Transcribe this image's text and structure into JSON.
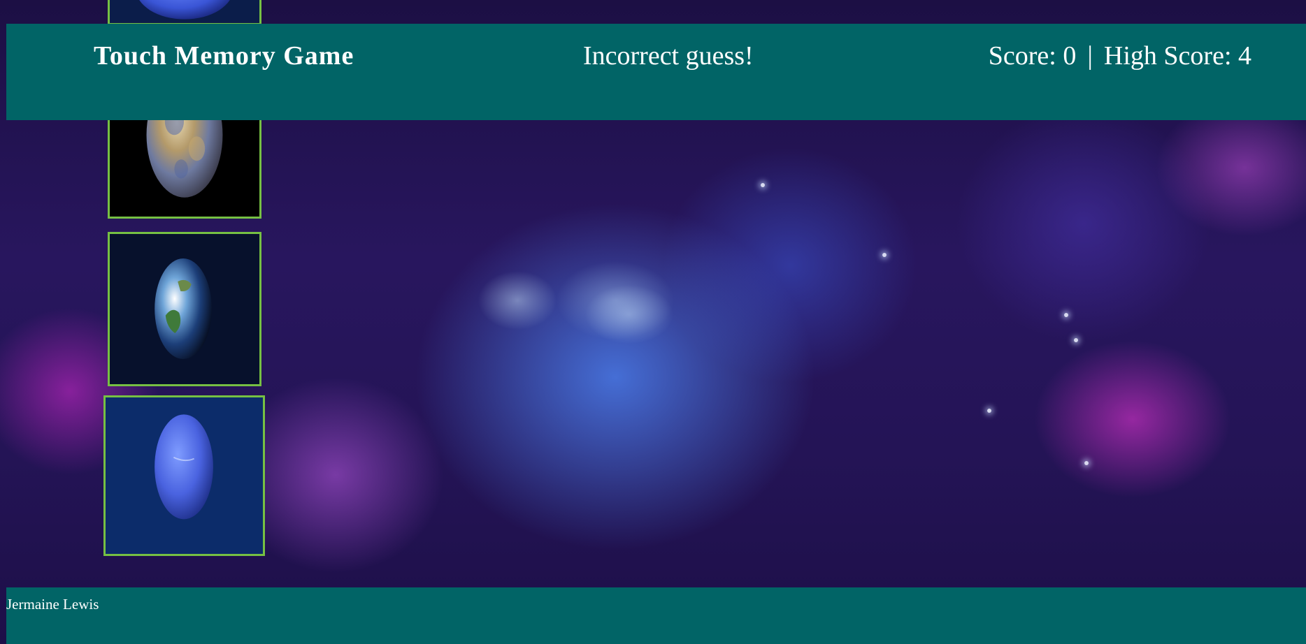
{
  "header": {
    "title": "Touch Memory Game",
    "message": "Incorrect guess!",
    "score_label": "Score: 0",
    "separator": "|",
    "high_score_label": "High Score: 4"
  },
  "cards": [
    {
      "name": "neptune-card-partial",
      "planet": "neptune"
    },
    {
      "name": "mercury-card",
      "planet": "mercury"
    },
    {
      "name": "earth-card",
      "planet": "earth"
    },
    {
      "name": "neptune-card",
      "planet": "neptune"
    }
  ],
  "footer": {
    "author": "Jermaine Lewis"
  },
  "colors": {
    "bar": "#016466",
    "card_border": "#76c043",
    "text": "#ffffff"
  }
}
